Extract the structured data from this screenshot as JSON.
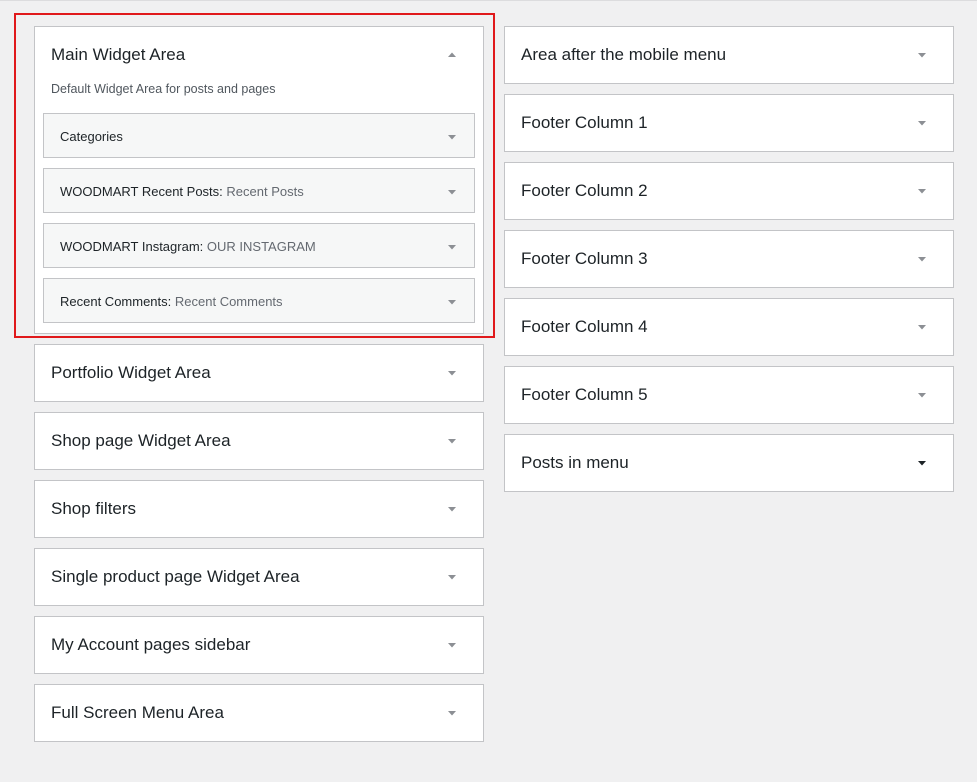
{
  "left_column": [
    {
      "title": "Main Widget Area",
      "expanded": true,
      "description": "Default Widget Area for posts and pages",
      "widgets": [
        {
          "name": "Categories",
          "subtitle": ""
        },
        {
          "name": "WOODMART Recent Posts:",
          "subtitle": "Recent Posts"
        },
        {
          "name": "WOODMART Instagram:",
          "subtitle": "OUR INSTAGRAM"
        },
        {
          "name": "Recent Comments:",
          "subtitle": "Recent Comments"
        }
      ]
    },
    {
      "title": "Portfolio Widget Area"
    },
    {
      "title": "Shop page Widget Area"
    },
    {
      "title": "Shop filters"
    },
    {
      "title": "Single product page Widget Area"
    },
    {
      "title": "My Account pages sidebar"
    },
    {
      "title": "Full Screen Menu Area"
    }
  ],
  "right_column": [
    {
      "title": "Area after the mobile menu"
    },
    {
      "title": "Footer Column 1"
    },
    {
      "title": "Footer Column 2"
    },
    {
      "title": "Footer Column 3"
    },
    {
      "title": "Footer Column 4"
    },
    {
      "title": "Footer Column 5"
    },
    {
      "title": "Posts in menu",
      "hovered": true
    }
  ],
  "icons": {
    "collapse": "arrow-up-icon",
    "expand": "arrow-down-icon"
  },
  "colors": {
    "page_bg": "#f0f0f1",
    "highlight": "#e0191b",
    "arrow": "#8c8f94",
    "arrow_hover": "#1d2327"
  }
}
